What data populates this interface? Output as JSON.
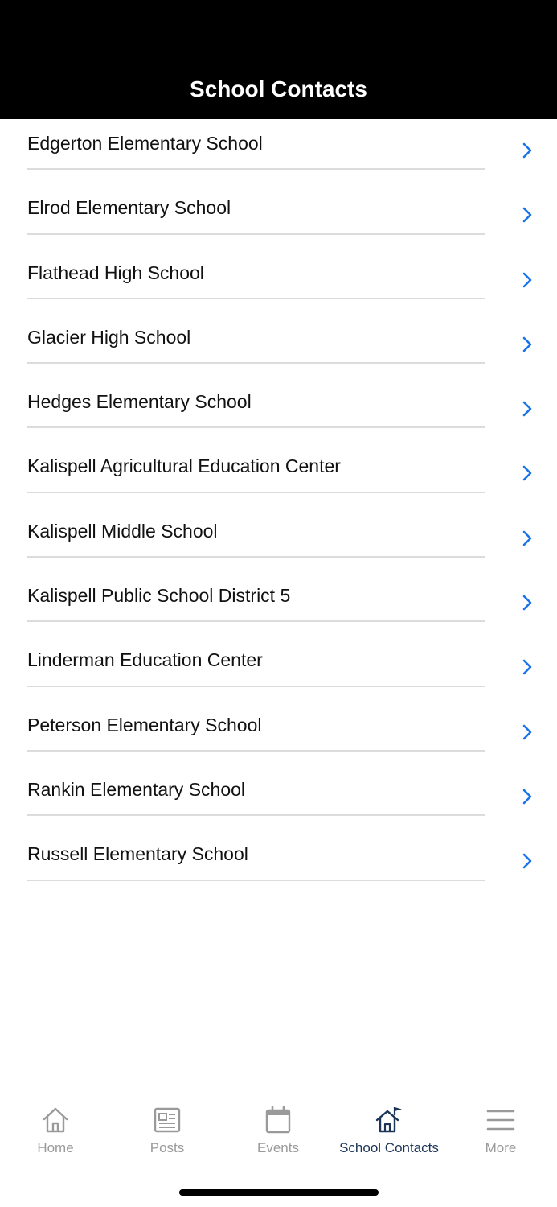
{
  "header": {
    "title": "School Contacts"
  },
  "schools": [
    {
      "name": "Edgerton Elementary School"
    },
    {
      "name": "Elrod Elementary School"
    },
    {
      "name": "Flathead High School"
    },
    {
      "name": "Glacier High School"
    },
    {
      "name": "Hedges Elementary School"
    },
    {
      "name": "Kalispell Agricultural Education Center"
    },
    {
      "name": "Kalispell Middle School"
    },
    {
      "name": "Kalispell Public School District 5"
    },
    {
      "name": "Linderman Education Center"
    },
    {
      "name": "Peterson Elementary School"
    },
    {
      "name": "Rankin Elementary School"
    },
    {
      "name": "Russell Elementary School"
    }
  ],
  "tabbar": {
    "tabs": [
      {
        "label": "Home",
        "icon": "home-icon"
      },
      {
        "label": "Posts",
        "icon": "newspaper-icon"
      },
      {
        "label": "Events",
        "icon": "calendar-icon"
      },
      {
        "label": "School Contacts",
        "icon": "school-flag-icon",
        "active": true
      },
      {
        "label": "More",
        "icon": "menu-icon"
      }
    ]
  },
  "colors": {
    "header_bg": "#000000",
    "header_text": "#ffffff",
    "chevron": "#1a73e8",
    "tab_inactive": "#9a9a9a",
    "tab_active": "#1c3557"
  }
}
